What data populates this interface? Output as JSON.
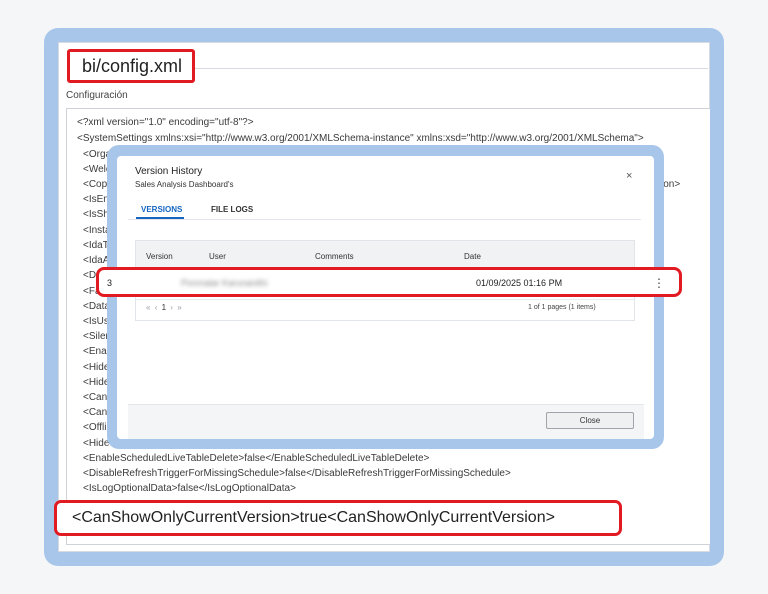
{
  "page": {
    "file_title": "bi/config.xml",
    "section_label": "Configuración",
    "code_lines": [
      "<?xml version=\"1.0\" encoding=\"utf-8\"?>",
      "<SystemSettings xmlns:xsi=\"http://www.w3.org/2001/XMLSchema-instance\" xmlns:xsd=\"http://www.w3.org/2001/XMLSchema\">",
      "<Orga",
      "<Welc",
      "<Cop",
      "<IsEn",
      "<IsSh",
      "<Insta",
      "<IdaT",
      "<IdaA",
      "<D",
      "<Fa",
      "<Data",
      "<IsUs",
      "<Siler",
      "<Enal",
      "<Hide",
      "<Hide",
      "<Can",
      "<Cans",
      "<Offli",
      "<Hide",
      "<EnableScheduledLiveTableDelete>false</EnableScheduledLiveTableDelete>",
      "<DisableRefreshTriggerForMissingSchedule>false</DisableRefreshTriggerForMissingSchedule>",
      "<IsLogOptionalData>false</IsLogOptionalData>"
    ],
    "code_tail_fragment": "ion>",
    "highlighted_line": "<CanShowOnlyCurrentVersion>true<CanShowOnlyCurrentVersion>"
  },
  "modal": {
    "title": "Version History",
    "subtitle": "Sales Analysis Dashboard's",
    "close_glyph": "×",
    "tabs": [
      "VERSIONS",
      "FILE LOGS"
    ],
    "columns": [
      "Version",
      "User",
      "Comments",
      "Date"
    ],
    "row": {
      "version": "3",
      "user": "Ponmalar Karunanithi",
      "comments": "",
      "date": "01/09/2025 01:16 PM",
      "menu_glyph": "⋮"
    },
    "pager": {
      "first": "«",
      "prev": "‹",
      "page": "1",
      "next": "›",
      "last": "»",
      "info": "1 of 1 pages (1 items)"
    },
    "close_button": "Close"
  },
  "colors": {
    "frame": "#a8c6ea",
    "highlight_border": "#e21b23",
    "active_tab": "#1565c0"
  }
}
